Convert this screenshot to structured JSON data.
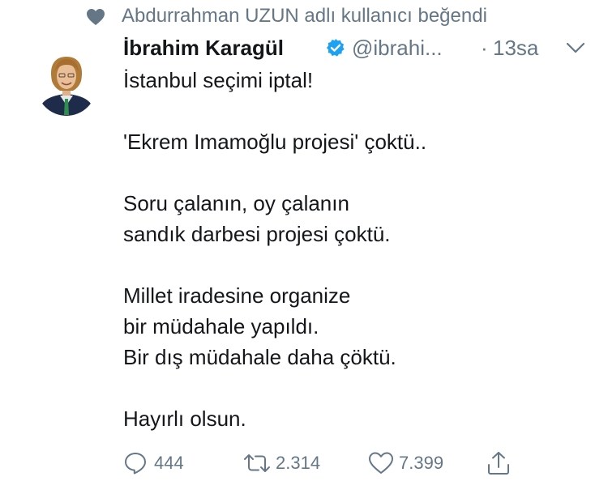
{
  "social_context": {
    "icon": "heart-icon",
    "text": "Abdurrahman UZUN adlı kullanıcı beğendi"
  },
  "author": {
    "avatar": "avatar-photo",
    "name": "İbrahim Karagül",
    "verified": true,
    "handle": "@ibrahi...",
    "separator": "·",
    "time": "13sa"
  },
  "tweet": {
    "lines": [
      "İstanbul seçimi iptal!",
      "",
      "'Ekrem Imamoğlu projesi' çoktü..",
      "",
      "Soru çalanın, oy çalanın",
      "sandık darbesi projesi çoktü.",
      "",
      "Millet iradesine organize",
      "bir müdahale yapıldı.",
      "Bir dış müdahale daha çöktü.",
      "",
      "Hayırlı olsun."
    ]
  },
  "actions": {
    "reply_count": "444",
    "retweet_count": "2.314",
    "like_count": "7.399"
  },
  "colors": {
    "text": "#14171a",
    "secondary": "#657786",
    "verified": "#1da1f2"
  }
}
